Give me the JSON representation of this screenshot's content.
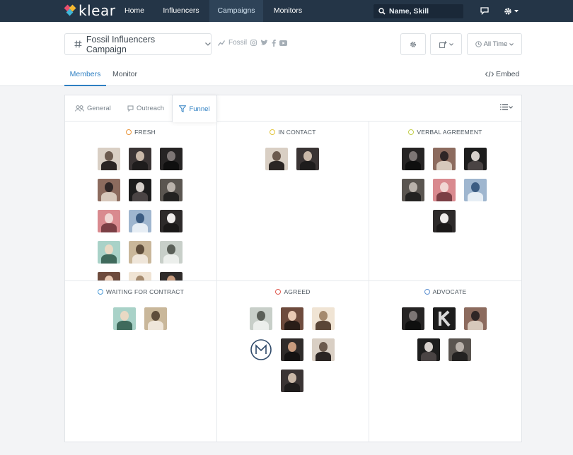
{
  "nav": {
    "logo_text": "klear",
    "links": [
      {
        "label": "Home",
        "active": false
      },
      {
        "label": "Influencers",
        "active": false
      },
      {
        "label": "Campaigns",
        "active": true
      },
      {
        "label": "Monitors",
        "active": false
      }
    ],
    "search_placeholder": "Name, Skill",
    "icons": [
      "search-icon",
      "chat-icon",
      "gear-icon",
      "caret-down-icon"
    ]
  },
  "header": {
    "campaign_name": "Fossil Influencers Campaign",
    "brand_name": "Fossil",
    "brand_socials": [
      "instagram-icon",
      "twitter-icon",
      "facebook-icon",
      "youtube-icon"
    ],
    "time_filter": "All Time",
    "tabs": [
      {
        "label": "Members",
        "active": true
      },
      {
        "label": "Monitor",
        "active": false
      }
    ],
    "embed_label": "Embed"
  },
  "board": {
    "view_tabs": [
      {
        "label": "General",
        "icon": "people-icon",
        "active": false
      },
      {
        "label": "Outreach",
        "icon": "speech-bubble-icon",
        "active": false
      },
      {
        "label": "Funnel",
        "icon": "funnel-icon",
        "active": true
      }
    ],
    "stages": [
      {
        "title": "FRESH",
        "dot_color": "#e8943a",
        "count": 15
      },
      {
        "title": "IN CONTACT",
        "dot_color": "#e2c43a",
        "count": 2
      },
      {
        "title": "VERBAL AGREEMENT",
        "dot_color": "#c3cf4a",
        "count": 7
      },
      {
        "title": "WAITING FOR CONTRACT",
        "dot_color": "#4a9ad6",
        "count": 2
      },
      {
        "title": "AGREED",
        "dot_color": "#e05a4f",
        "count": 7
      },
      {
        "title": "ADVOCATE",
        "dot_color": "#5b8fd0",
        "count": 5
      }
    ]
  },
  "colors": {
    "nav_bg": "#243547",
    "accent": "#2e7fc2"
  }
}
